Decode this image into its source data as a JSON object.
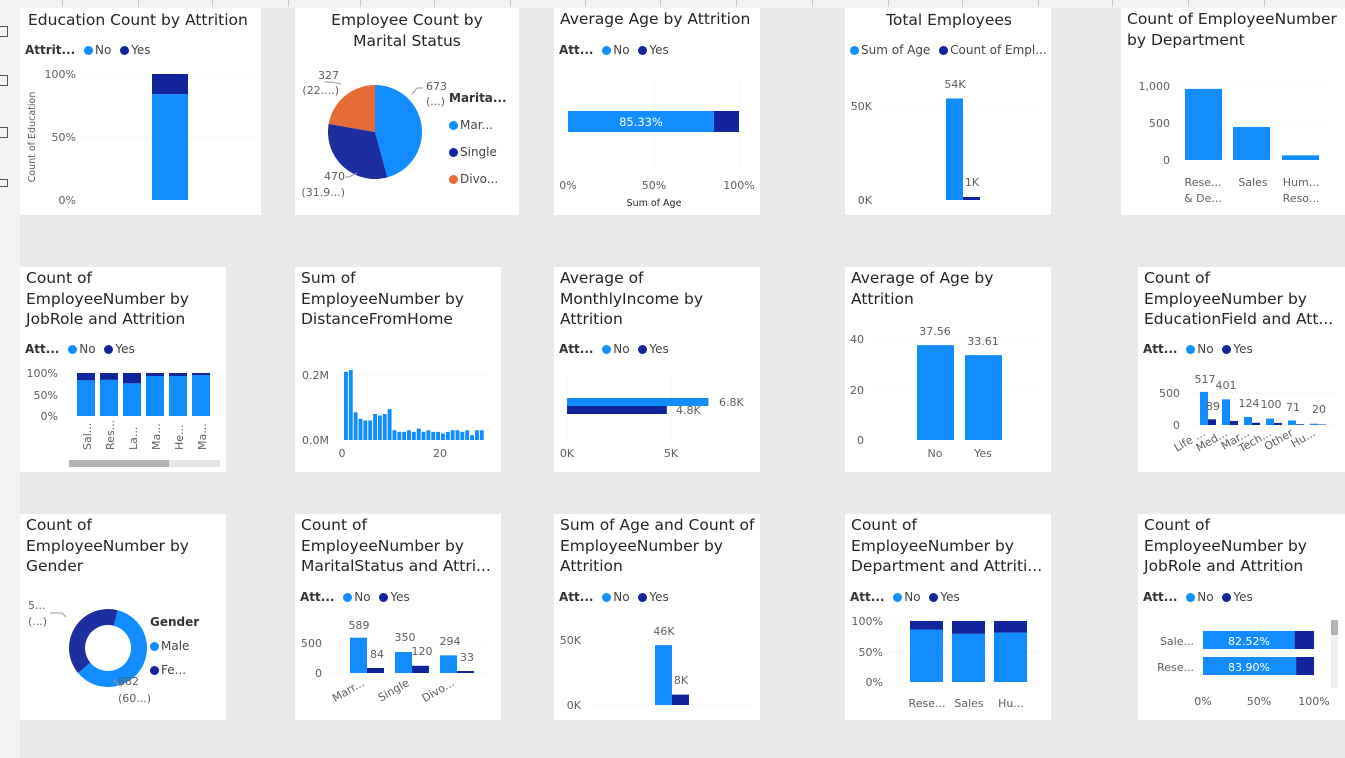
{
  "colors": {
    "no": "#118dff",
    "yes": "#12239e",
    "divorced": "#e66c37"
  },
  "charts": {
    "edu": {
      "title": "Education Count by Attrition",
      "legend_label": "Attrit...",
      "legend": [
        "No",
        "Yes"
      ],
      "ylabel": "Count of Education",
      "yticks": [
        "100%",
        "50%",
        "0%"
      ]
    },
    "marital": {
      "title": "Employee Count by Marital Status",
      "legend_title": "Marita...",
      "legend": [
        "Mar...",
        "Single",
        "Divo..."
      ],
      "labels": {
        "married": [
          "673",
          "(...)"
        ],
        "single": [
          "470",
          "(31.9...)"
        ],
        "divorced": [
          "327",
          "(22....)"
        ]
      }
    },
    "avgage": {
      "title": "Average Age by Attrition",
      "legend_label": "Att...",
      "legend": [
        "No",
        "Yes"
      ],
      "bar_label": "85.33%",
      "xticks": [
        "0%",
        "50%",
        "100%"
      ],
      "xlabel": "Sum of Age"
    },
    "total": {
      "title": "Total Employees",
      "legend": [
        "Sum of Age",
        "Count of Empl..."
      ],
      "yticks": [
        "50K",
        "0K"
      ],
      "labels": [
        "54K",
        "1K"
      ]
    },
    "dept": {
      "title": "Count of EmployeeNumber by Department",
      "yticks": [
        "1,000",
        "500",
        "0"
      ],
      "categories": [
        [
          "Rese...",
          "& De..."
        ],
        [
          "Sales",
          ""
        ],
        [
          "Hum...",
          "Reso..."
        ]
      ]
    },
    "jobrole": {
      "title": "Count of EmployeeNumber by JobRole and Attrition",
      "legend_label": "Att...",
      "legend": [
        "No",
        "Yes"
      ],
      "yticks": [
        "100%",
        "50%",
        "0%"
      ],
      "categories": [
        "Sal...",
        "Res...",
        "La...",
        "Ma...",
        "He...",
        "Ma..."
      ]
    },
    "distance": {
      "title": "Sum of EmployeeNumber by DistanceFromHome",
      "yticks": [
        "0.2M",
        "0.0M"
      ],
      "xticks": [
        "0",
        "20"
      ]
    },
    "income": {
      "title": "Average of MonthlyIncome by Attrition",
      "legend_label": "Att...",
      "legend": [
        "No",
        "Yes"
      ],
      "labels": [
        "6.8K",
        "4.8K"
      ],
      "xticks": [
        "0K",
        "5K"
      ]
    },
    "avgage2": {
      "title": "Average of Age by Attrition",
      "yticks": [
        "40",
        "20",
        "0"
      ],
      "labels": [
        "37.56",
        "33.61"
      ],
      "categories": [
        "No",
        "Yes"
      ]
    },
    "edufield": {
      "title": "Count of EmployeeNumber by EducationField and Att...",
      "legend_label": "Att...",
      "legend": [
        "No",
        "Yes"
      ],
      "yticks": [
        "500",
        "0"
      ],
      "labels": [
        "517",
        "401",
        "89",
        "124",
        "100",
        "71",
        "20"
      ],
      "categories": [
        "Life ...",
        "Med...",
        "Mar...",
        "Tech...",
        "Other",
        "Hu..."
      ]
    },
    "gender": {
      "title": "Count of EmployeeNumber by Gender",
      "legend_title": "Gender",
      "legend": [
        "Male",
        "Fe..."
      ],
      "labels": {
        "female": [
          "5...",
          "(...)"
        ],
        "male": [
          "882",
          "(60...)"
        ]
      }
    },
    "maritalatt": {
      "title": "Count of EmployeeNumber by MaritalStatus and Attri...",
      "legend_label": "Att...",
      "legend": [
        "No",
        "Yes"
      ],
      "yticks": [
        "500",
        "0"
      ],
      "labels": [
        "589",
        "84",
        "350",
        "120",
        "294",
        "33"
      ],
      "categories": [
        "Marr...",
        "Single",
        "Divo..."
      ]
    },
    "sumage": {
      "title": "Sum of Age and Count of EmployeeNumber by Attrition",
      "legend_label": "Att...",
      "legend": [
        "No",
        "Yes"
      ],
      "yticks": [
        "50K",
        "0K"
      ],
      "labels": [
        "46K",
        "8K"
      ]
    },
    "deptatt": {
      "title": "Count of EmployeeNumber by Department and Attriti...",
      "legend_label": "Att...",
      "legend": [
        "No",
        "Yes"
      ],
      "yticks": [
        "100%",
        "50%",
        "0%"
      ],
      "categories": [
        "Rese...",
        "Sales",
        "Hu..."
      ]
    },
    "jobrole2": {
      "title": "Count of EmployeeNumber by JobRole and Attrition",
      "legend_label": "Att...",
      "legend": [
        "No",
        "Yes"
      ],
      "rows": [
        "Sale...",
        "Rese..."
      ],
      "labels": [
        "82.52%",
        "83.90%"
      ],
      "xticks": [
        "0%",
        "50%",
        "100%"
      ]
    }
  },
  "chart_data": [
    {
      "type": "bar",
      "title": "Education Count by Attrition",
      "ylabel": "Count of Education",
      "ylim": [
        0,
        1
      ],
      "categories": [
        ""
      ],
      "series": [
        {
          "name": "No",
          "values": [
            0.84
          ]
        },
        {
          "name": "Yes",
          "values": [
            0.16
          ]
        }
      ]
    },
    {
      "type": "pie",
      "title": "Employee Count by Marital Status",
      "categories": [
        "Married",
        "Single",
        "Divorced"
      ],
      "values": [
        673,
        470,
        327
      ]
    },
    {
      "type": "bar",
      "orientation": "horizontal",
      "title": "Average Age by Attrition",
      "xlabel": "Sum of Age",
      "series": [
        {
          "name": "No",
          "values": [
            0.8533
          ]
        },
        {
          "name": "Yes",
          "values": [
            0.1467
          ]
        }
      ]
    },
    {
      "type": "bar",
      "title": "Total Employees",
      "series": [
        {
          "name": "Sum of Age",
          "values": [
            54000
          ]
        },
        {
          "name": "Count of EmployeeNumber",
          "values": [
            1470
          ]
        }
      ],
      "ylim": [
        0,
        60000
      ]
    },
    {
      "type": "bar",
      "title": "Count of EmployeeNumber by Department",
      "categories": [
        "Research & Development",
        "Sales",
        "Human Resources"
      ],
      "values": [
        961,
        446,
        63
      ],
      "ylim": [
        0,
        1000
      ]
    },
    {
      "type": "bar",
      "title": "Count of EmployeeNumber by JobRole and Attrition",
      "categories": [
        "Sal...",
        "Res...",
        "La...",
        "Ma...",
        "He...",
        "Ma..."
      ],
      "series": [
        {
          "name": "No",
          "values": [
            0.83,
            0.84,
            0.76,
            0.93,
            0.93,
            0.95
          ]
        },
        {
          "name": "Yes",
          "values": [
            0.17,
            0.16,
            0.24,
            0.07,
            0.07,
            0.05
          ]
        }
      ],
      "ylim": [
        0,
        1
      ]
    },
    {
      "type": "bar",
      "title": "Sum of EmployeeNumber by DistanceFromHome",
      "x": [
        1,
        2,
        3,
        4,
        5,
        6,
        7,
        8,
        9,
        10,
        11,
        12,
        13,
        14,
        15,
        16,
        17,
        18,
        19,
        20,
        21,
        22,
        23,
        24,
        25,
        26,
        27,
        28,
        29
      ],
      "values": [
        210000,
        215000,
        85000,
        65000,
        60000,
        60000,
        80000,
        75000,
        80000,
        95000,
        30000,
        25000,
        25000,
        30000,
        25000,
        35000,
        25000,
        30000,
        25000,
        25000,
        20000,
        25000,
        30000,
        30000,
        25000,
        30000,
        15000,
        30000,
        30000
      ],
      "ylim": [
        0,
        250000
      ]
    },
    {
      "type": "bar",
      "orientation": "horizontal",
      "title": "Average of MonthlyIncome by Attrition",
      "categories": [
        "No",
        "Yes"
      ],
      "values": [
        6800,
        4800
      ]
    },
    {
      "type": "bar",
      "title": "Average of Age by Attrition",
      "categories": [
        "No",
        "Yes"
      ],
      "values": [
        37.56,
        33.61
      ],
      "ylim": [
        0,
        40
      ]
    },
    {
      "type": "bar",
      "title": "Count of EmployeeNumber by EducationField and Attrition",
      "categories": [
        "Life Sciences",
        "Medical",
        "Marketing",
        "Technical Degree",
        "Other",
        "Human Resources"
      ],
      "series": [
        {
          "name": "No",
          "values": [
            517,
            401,
            124,
            100,
            71,
            20
          ]
        },
        {
          "name": "Yes",
          "values": [
            89,
            63,
            35,
            32,
            11,
            7
          ]
        }
      ]
    },
    {
      "type": "pie",
      "title": "Count of EmployeeNumber by Gender",
      "categories": [
        "Male",
        "Female"
      ],
      "values": [
        882,
        588
      ]
    },
    {
      "type": "bar",
      "title": "Count of EmployeeNumber by MaritalStatus and Attrition",
      "categories": [
        "Married",
        "Single",
        "Divorced"
      ],
      "series": [
        {
          "name": "No",
          "values": [
            589,
            350,
            294
          ]
        },
        {
          "name": "Yes",
          "values": [
            84,
            120,
            33
          ]
        }
      ]
    },
    {
      "type": "bar",
      "title": "Sum of Age and Count of EmployeeNumber by Attrition",
      "series": [
        {
          "name": "No",
          "values": [
            46000
          ]
        },
        {
          "name": "Yes",
          "values": [
            8000
          ]
        }
      ],
      "ylim": [
        0,
        55000
      ]
    },
    {
      "type": "bar",
      "title": "Count of EmployeeNumber by Department and Attrition",
      "categories": [
        "Research & Development",
        "Sales",
        "Human Resources"
      ],
      "series": [
        {
          "name": "No",
          "values": [
            0.86,
            0.79,
            0.81
          ]
        },
        {
          "name": "Yes",
          "values": [
            0.14,
            0.21,
            0.19
          ]
        }
      ],
      "ylim": [
        0,
        1
      ]
    },
    {
      "type": "bar",
      "orientation": "horizontal",
      "title": "Count of EmployeeNumber by JobRole and Attrition",
      "categories": [
        "Sale...",
        "Rese..."
      ],
      "series": [
        {
          "name": "No",
          "values": [
            0.8252,
            0.839
          ]
        },
        {
          "name": "Yes",
          "values": [
            0.1748,
            0.161
          ]
        }
      ]
    }
  ]
}
